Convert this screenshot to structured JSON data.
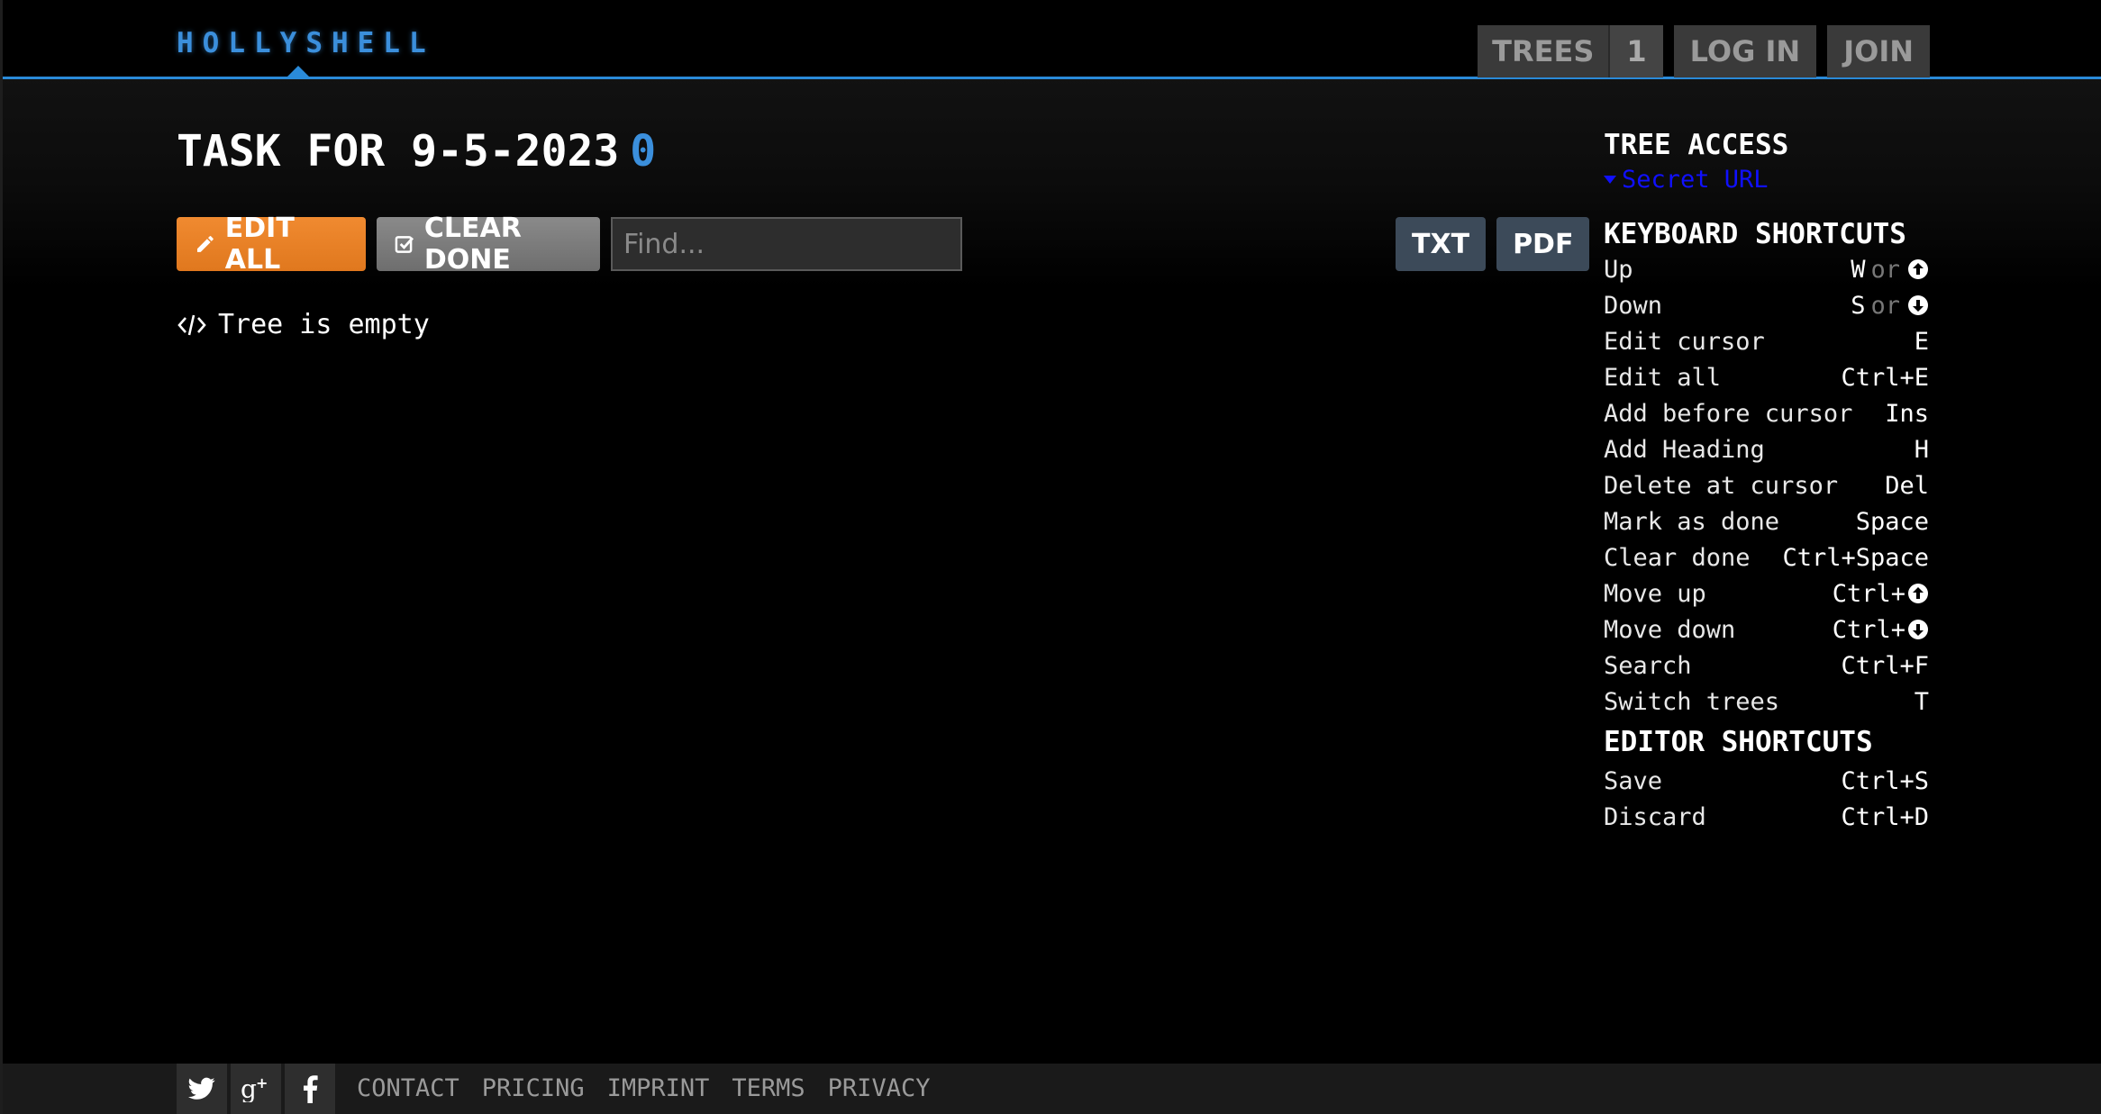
{
  "header": {
    "logo": "HOLLYSHELL",
    "nav": {
      "trees_label": "TREES",
      "trees_count": "1",
      "login_label": "LOG IN",
      "join_label": "JOIN"
    }
  },
  "main": {
    "title": "TASK FOR 9-5-2023",
    "title_count": "0",
    "toolbar": {
      "edit_all_label": "EDIT ALL",
      "clear_done_label": "CLEAR DONE",
      "find_placeholder": "Find..."
    },
    "export": {
      "txt_label": "TXT",
      "pdf_label": "PDF"
    },
    "empty_message": "Tree is empty"
  },
  "sidebar": {
    "tree_access_heading": "TREE ACCESS",
    "secret_url_label": "Secret URL",
    "keyboard_heading": "KEYBOARD SHORTCUTS",
    "keyboard": [
      {
        "action": "Up",
        "key": "W",
        "or": "or",
        "icon": "arrow-up-circle-icon"
      },
      {
        "action": "Down",
        "key": "S",
        "or": "or",
        "icon": "arrow-down-circle-icon"
      },
      {
        "action": "Edit cursor",
        "key": "E"
      },
      {
        "action": "Edit all",
        "key": "Ctrl+E"
      },
      {
        "action": "Add before cursor",
        "key": "Ins"
      },
      {
        "action": "Add Heading",
        "key": "H"
      },
      {
        "action": "Delete at cursor",
        "key": "Del"
      },
      {
        "action": "Mark as done",
        "key": "Space"
      },
      {
        "action": "Clear done",
        "key": "Ctrl+Space"
      },
      {
        "action": "Move up",
        "key": "Ctrl+",
        "icon": "arrow-up-circle-icon"
      },
      {
        "action": "Move down",
        "key": "Ctrl+",
        "icon": "arrow-down-circle-icon"
      },
      {
        "action": "Search",
        "key": "Ctrl+F"
      },
      {
        "action": "Switch trees",
        "key": "T"
      }
    ],
    "editor_heading": "EDITOR SHORTCUTS",
    "editor": [
      {
        "action": "Save",
        "key": "Ctrl+S"
      },
      {
        "action": "Discard",
        "key": "Ctrl+D"
      }
    ]
  },
  "footer": {
    "social": [
      "twitter-icon",
      "google-plus-icon",
      "facebook-icon"
    ],
    "links": [
      "CONTACT",
      "PRICING",
      "IMPRINT",
      "TERMS",
      "PRIVACY"
    ]
  },
  "colors": {
    "accent_blue": "#3b8fdc",
    "edit_orange": "#e98228",
    "secret_link": "#1010ff"
  }
}
